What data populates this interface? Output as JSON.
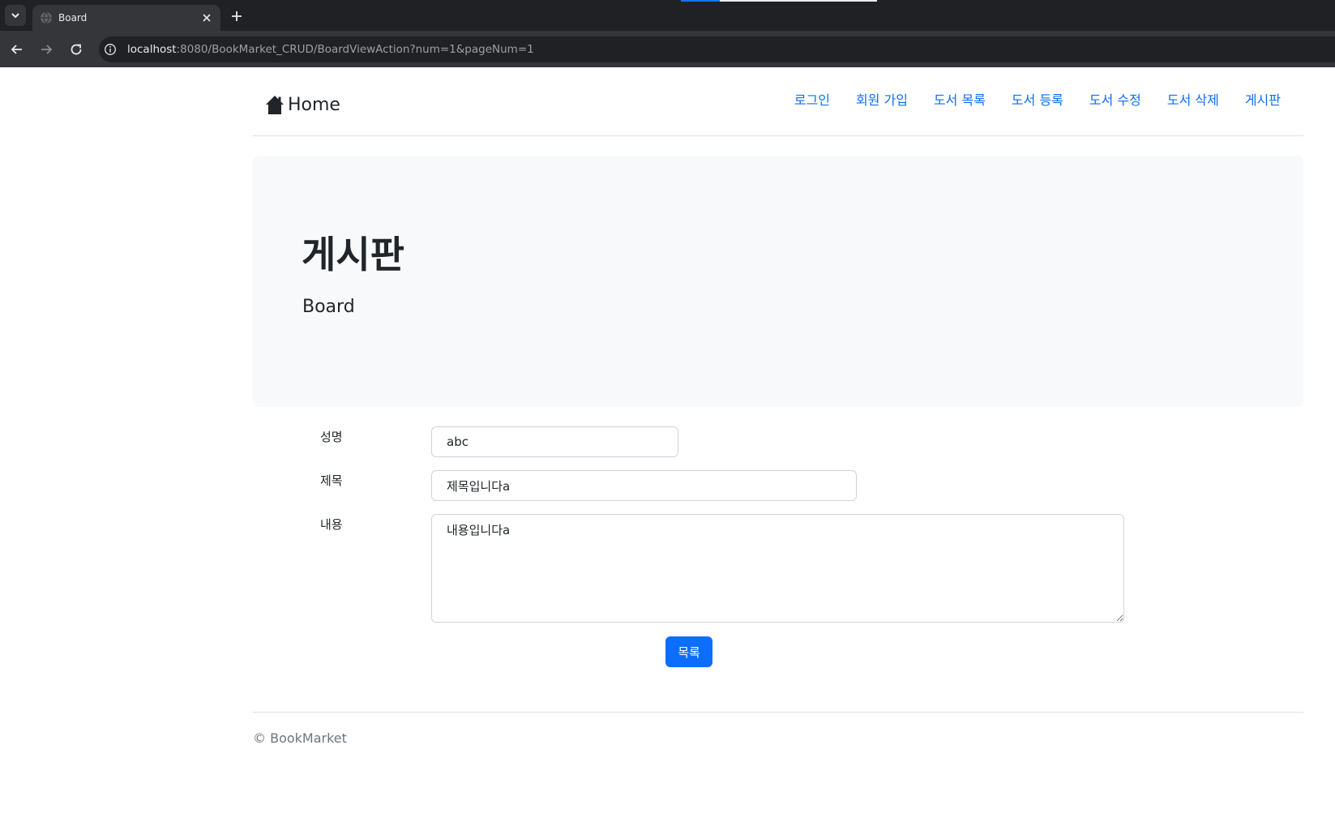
{
  "browser": {
    "tab_title": "Board",
    "url_host": "localhost",
    "url_rest": ":8080/BookMarket_CRUD/BoardViewAction?num=1&pageNum=1"
  },
  "nav": {
    "brand": "Home",
    "links": [
      "로그인",
      "회원 가입",
      "도서 목록",
      "도서 등록",
      "도서 수정",
      "도서 삭제",
      "게시판"
    ]
  },
  "jumbotron": {
    "title": "게시판",
    "subtitle": "Board"
  },
  "form": {
    "name_label": "성명",
    "name_value": "abc",
    "subject_label": "제목",
    "subject_value": "제목입니다a",
    "content_label": "내용",
    "content_value": "내용입니다a",
    "list_button": "목록"
  },
  "footer": {
    "text": "© BookMarket"
  },
  "colors": {
    "link": "#0d6efd",
    "button": "#0d6efd",
    "jumbotron_bg": "#f8f9fa"
  },
  "icons": [
    "tab-search-icon",
    "globe-icon",
    "close-icon",
    "plus-icon",
    "back-arrow-icon",
    "forward-arrow-icon",
    "reload-icon",
    "info-icon",
    "house-icon"
  ]
}
